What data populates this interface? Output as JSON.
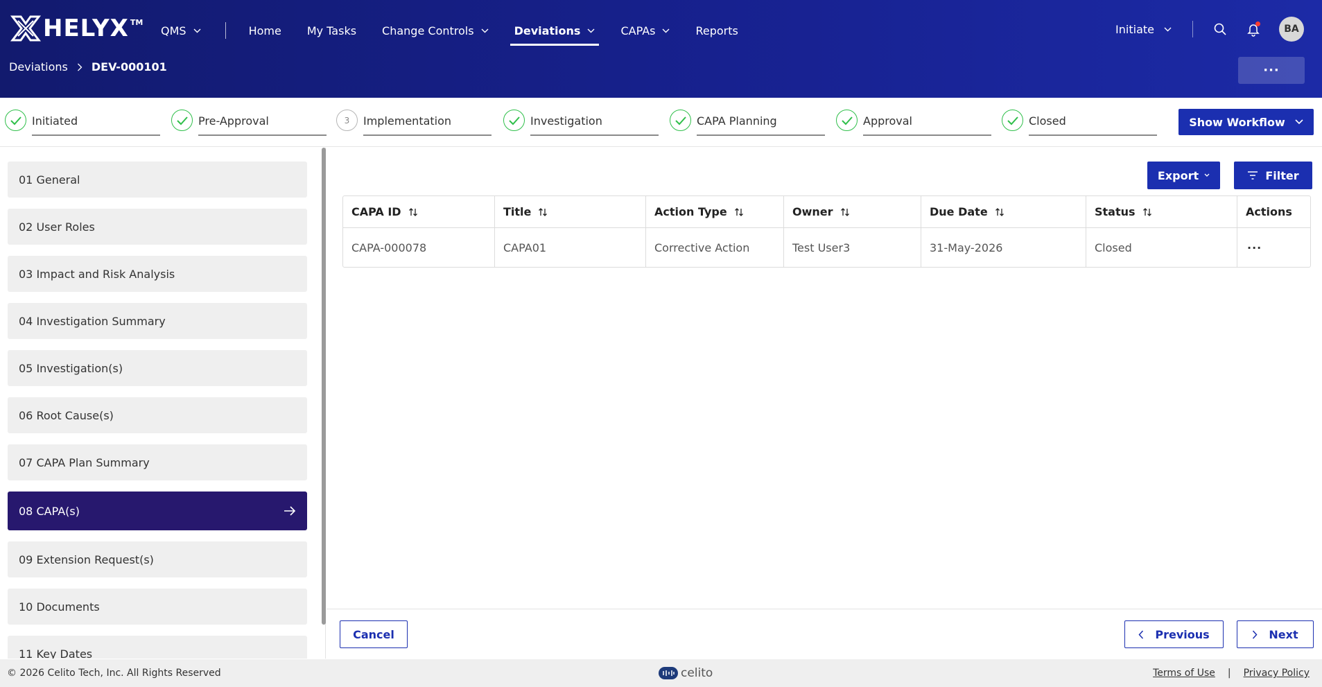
{
  "app": {
    "logo_text": "HELYX",
    "logo_tm": "TM"
  },
  "nav": {
    "items": [
      {
        "label": "QMS"
      },
      {
        "label": "Home"
      },
      {
        "label": "My Tasks"
      },
      {
        "label": "Change Controls"
      },
      {
        "label": "Deviations"
      },
      {
        "label": "CAPAs"
      },
      {
        "label": "Reports"
      }
    ],
    "active": "Deviations",
    "initiate_label": "Initiate",
    "avatar_initials": "BA",
    "accent_color": "#1b2fb0",
    "header_color": "#17218f"
  },
  "breadcrumb": {
    "parent": "Deviations",
    "current": "DEV-000101"
  },
  "more_label": "···",
  "workflow": {
    "steps": [
      {
        "label": "Initiated",
        "status": "done"
      },
      {
        "label": "Pre-Approval",
        "status": "done"
      },
      {
        "label": "Implementation",
        "status": "pending",
        "number": "3"
      },
      {
        "label": "Investigation",
        "status": "done"
      },
      {
        "label": "CAPA Planning",
        "status": "done"
      },
      {
        "label": "Approval",
        "status": "done"
      },
      {
        "label": "Closed",
        "status": "done"
      }
    ],
    "show_workflow_label": "Show Workflow"
  },
  "sidebar": {
    "items": [
      {
        "label": "01 General"
      },
      {
        "label": "02 User Roles"
      },
      {
        "label": "03 Impact and Risk Analysis"
      },
      {
        "label": "04 Investigation Summary"
      },
      {
        "label": "05 Investigation(s)"
      },
      {
        "label": "06 Root Cause(s)"
      },
      {
        "label": "07 CAPA Plan Summary"
      },
      {
        "label": "08 CAPA(s)"
      },
      {
        "label": "09 Extension Request(s)"
      },
      {
        "label": "10 Documents"
      },
      {
        "label": "11 Key Dates"
      }
    ],
    "active_index": 7,
    "active_color": "#27186e"
  },
  "main": {
    "export_label": "Export",
    "filter_label": "Filter",
    "table": {
      "headers": [
        "CAPA ID",
        "Title",
        "Action Type",
        "Owner",
        "Due Date",
        "Status",
        "Actions"
      ],
      "rows": [
        [
          "CAPA-000078",
          "CAPA01",
          "Corrective Action",
          "Test User3",
          "31-May-2026",
          "Closed",
          "···"
        ]
      ]
    }
  },
  "actions": {
    "cancel": "Cancel",
    "previous": "Previous",
    "next": "Next"
  },
  "footer": {
    "copyright": "© 2026 Celito Tech, Inc. All Rights Reserved",
    "brand": "celito",
    "terms": "Terms of Use",
    "separator": "|",
    "privacy": "Privacy Policy"
  }
}
